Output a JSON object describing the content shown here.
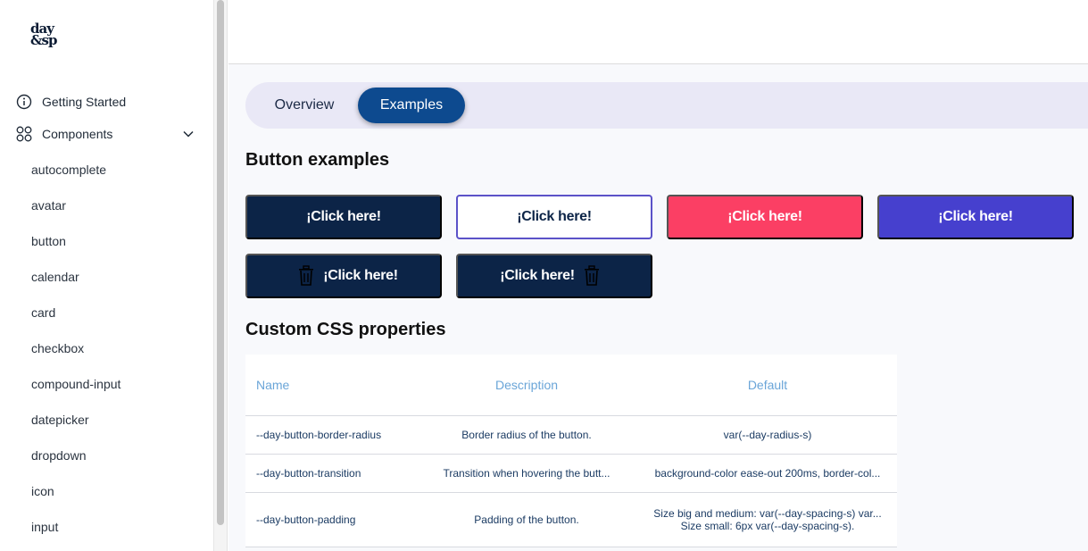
{
  "logo": {
    "line1": "day",
    "line2": "&sp"
  },
  "sidebar": {
    "top_items": [
      {
        "label": "Getting Started",
        "icon": "info-icon"
      },
      {
        "label": "Components",
        "icon": "grid-icon",
        "expanded": true
      }
    ],
    "sub_items": [
      "autocomplete",
      "avatar",
      "button",
      "calendar",
      "card",
      "checkbox",
      "compound-input",
      "datepicker",
      "dropdown",
      "icon",
      "input"
    ]
  },
  "tabs": {
    "overview": "Overview",
    "examples": "Examples",
    "active": "examples"
  },
  "headings": {
    "buttons": "Button examples",
    "css": "Custom CSS properties"
  },
  "buttons": {
    "label": "¡Click here!",
    "variants": [
      "primary",
      "secondary",
      "danger",
      "accent",
      "primary-icon-left",
      "primary-icon-right"
    ]
  },
  "table": {
    "headers": {
      "name": "Name",
      "description": "Description",
      "default": "Default"
    },
    "rows": [
      {
        "name": "--day-button-border-radius",
        "description": "Border radius of the button.",
        "default": [
          "var(--day-radius-s)"
        ]
      },
      {
        "name": "--day-button-transition",
        "description": "Transition when hovering the butt...",
        "default": [
          "background-color ease-out 200ms, border-col..."
        ]
      },
      {
        "name": "--day-button-padding",
        "description": "Padding of the button.",
        "default": [
          "Size big and medium: var(--day-spacing-s) var...",
          "Size small: 6px var(--day-spacing-s)."
        ]
      }
    ]
  },
  "colors": {
    "primary": "#0c2447",
    "secondary_border": "#5b52c8",
    "danger": "#fb3f64",
    "accent": "#4640ce",
    "tab_active": "#0d4a8f",
    "tab_bar": "#e9e8f6",
    "table_header": "#6aa5d8"
  }
}
